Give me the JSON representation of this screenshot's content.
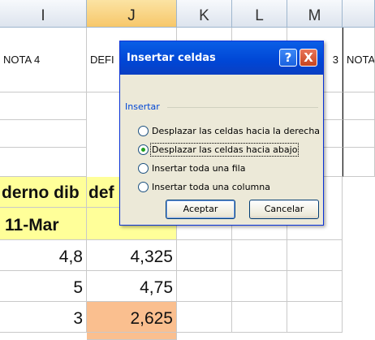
{
  "columns": [
    "I",
    "J",
    "K",
    "L",
    "M"
  ],
  "selected_column": "J",
  "sheet": {
    "header_row": [
      "NOTA 4",
      "DEFI",
      "",
      "",
      "3",
      "NOTA"
    ],
    "title_row": [
      "derno dib",
      "def"
    ],
    "date_row": "11-Mar",
    "rows": [
      {
        "i": "4,8",
        "j": "4,325"
      },
      {
        "i": "5",
        "j": "4,75"
      },
      {
        "i": "3",
        "j": "2,625"
      }
    ]
  },
  "dialog": {
    "title": "Insertar celdas",
    "help_label": "?",
    "close_label": "X",
    "group_label": "Insertar",
    "options": [
      {
        "label": "Desplazar las celdas hacia la derecha",
        "checked": false
      },
      {
        "label": "Desplazar las celdas hacia abajo",
        "checked": true
      },
      {
        "label": "Insertar toda una fila",
        "checked": false
      },
      {
        "label": "Insertar toda una columna",
        "checked": false
      }
    ],
    "ok_label": "Aceptar",
    "cancel_label": "Cancelar"
  },
  "colors": {
    "title_bar": "#0046d5",
    "selected_column_header": "#f7c76a",
    "yellow_fill": "#ffff99",
    "orange_fill": "#fabf8f"
  }
}
